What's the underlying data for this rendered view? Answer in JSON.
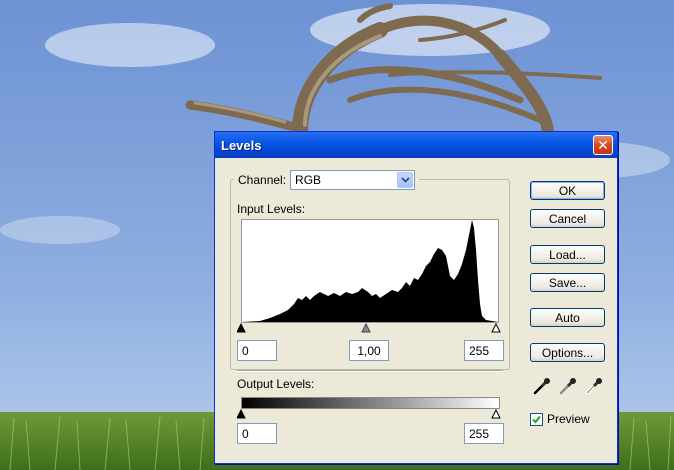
{
  "dialog": {
    "title": "Levels",
    "close_glyph": "✕",
    "channel": {
      "label": "Channel:",
      "selected": "RGB"
    },
    "input_levels": {
      "label": "Input Levels:",
      "black": "0",
      "gamma": "1,00",
      "white": "255"
    },
    "output_levels": {
      "label": "Output Levels:",
      "black": "0",
      "white": "255"
    },
    "buttons": {
      "ok": "OK",
      "cancel": "Cancel",
      "load": "Load...",
      "save": "Save...",
      "auto": "Auto",
      "options": "Options..."
    },
    "preview": {
      "label": "Preview",
      "checked": true
    }
  },
  "icons": [
    "close-icon",
    "chevron-down-icon",
    "black-eyedropper-icon",
    "gray-eyedropper-icon",
    "white-eyedropper-icon",
    "checkmark-icon"
  ],
  "colors": {
    "titlebar": "#0a5ae8",
    "dialog_bg": "#ece9d8",
    "button_border": "#003c74",
    "close_button": "#d5451a",
    "sky": "#7f9fd6",
    "grass": "#5a8a2c"
  }
}
